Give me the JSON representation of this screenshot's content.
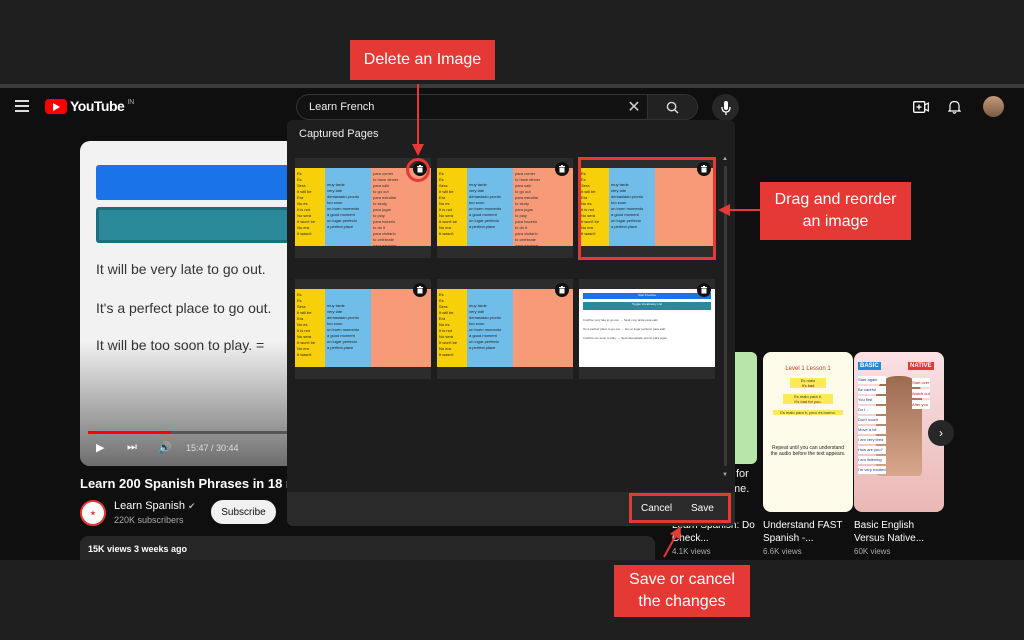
{
  "header": {
    "search_value": "Learn French",
    "logo_text": "YouTube",
    "logo_region": "IN"
  },
  "video": {
    "lines": [
      "It will be very late to go out.",
      "It's a perfect place to go out.",
      "It will be too soon to play. ="
    ],
    "time": "15:47 / 30:44",
    "title": "Learn 200 Spanish Phrases in 18 m",
    "channel": "Learn Spanish",
    "subscribers": "220K subscribers",
    "subscribe_label": "Subscribe",
    "meta": "15K views  3 weeks ago"
  },
  "modal": {
    "title": "Captured Pages",
    "cancel_label": "Cancel",
    "save_label": "Save"
  },
  "cards": [
    {
      "style": "yellow-blue-pink"
    },
    {
      "style": "yellow-blue-pink"
    },
    {
      "style": "yellow-blue-peach"
    },
    {
      "style": "yellow-blue-peach"
    },
    {
      "style": "yellow-blue-peach"
    },
    {
      "style": "white-buttons"
    }
  ],
  "card_text": {
    "col1": [
      "Es",
      "Es",
      "Sera",
      "It will be",
      "Era",
      "No es",
      "It is not",
      "No será",
      "It won't be",
      "No era",
      "It wasn't"
    ],
    "col2": [
      "muy tarde",
      "very late",
      "demasiado pronto",
      "too soon",
      "un buen momento",
      "a good moment",
      "un lugar perfecto",
      "a perfect place"
    ],
    "col3": [
      "para comer",
      "to have dinner",
      "para salir",
      "to go out",
      "para estudiar",
      "to study",
      "para jugar",
      "to play",
      "para hacerlo",
      "to do it",
      "para visitarlo",
      "to celebrate",
      "para explorar",
      "to explore",
      "para cambiarlo",
      "to change it"
    ],
    "white_btn1": "Start Practice",
    "white_btn2": "Toggle Vocabulary List",
    "white_lines": [
      "It will be very late to go out. → Será muy tarde para salir.",
      "It's a perfect place to go out. → Es un lugar perfecto para salir.",
      "It will be too soon to play. → Será demasiado pronto para jugar."
    ]
  },
  "thumbnails": [
    {
      "title": "Learn Spanish: Do Check...",
      "views": "4.1K views"
    },
    {
      "title": "Understand FAST Spanish -...",
      "views": "6.6K views",
      "heading": "Level 1 Lesson 1",
      "bubbles": [
        "Es malo",
        "It's bad",
        "Es malo para ti.",
        "It's bad for you.",
        "Es malo para ti, pero es bueno.",
        "Repeat until you can understand the audio before the text appears."
      ]
    },
    {
      "title": "Basic English Versus Native...",
      "views": "60K views",
      "tags": [
        "BASIC",
        "NATIVE",
        "Start again",
        "Start over",
        "Be careful",
        "Watch out",
        "You first",
        "After you",
        "Do I...",
        "Don't touch",
        "Move a bit",
        "I am very tired",
        "How are you?",
        "I am listening",
        "I'm very excited"
      ]
    }
  ],
  "partial_thumb_text": [
    "for",
    "me."
  ],
  "callouts": {
    "delete": "Delete an Image",
    "drag": "Drag and reorder an image",
    "save": "Save or cancel the changes"
  },
  "colors": {
    "accent_red": "#e53935",
    "youtube_red": "#ff0000",
    "card_yellow": "#f8d00a",
    "card_blue": "#6fbde8",
    "card_pink": "#f79a78"
  }
}
